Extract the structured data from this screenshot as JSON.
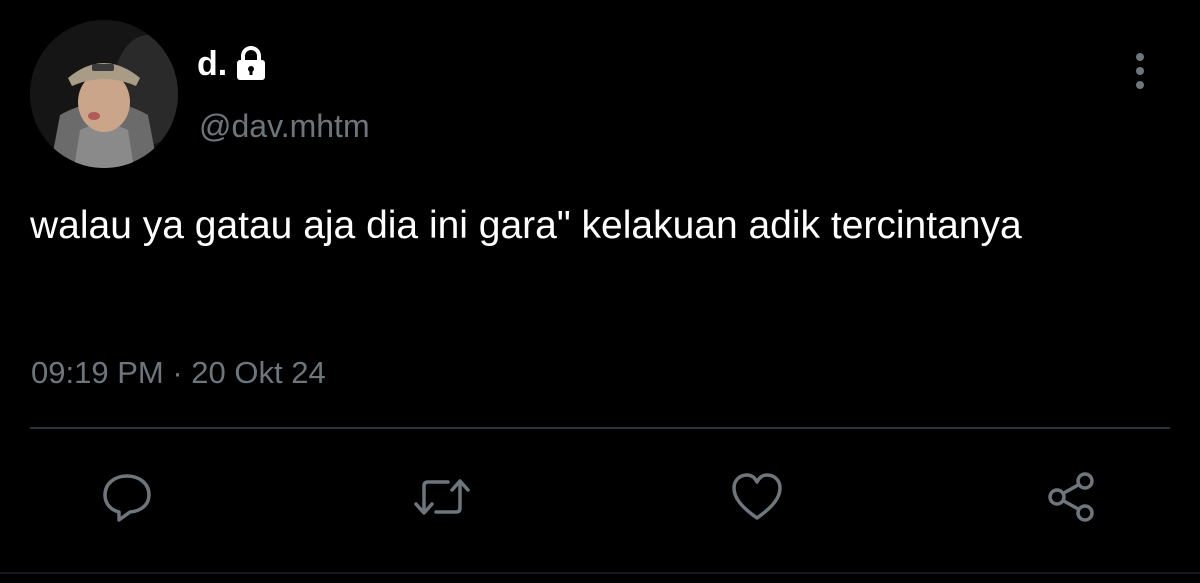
{
  "user": {
    "display_name": "d.",
    "handle": "@dav.mhtm",
    "protected": true,
    "avatar": "user-avatar-photo"
  },
  "tweet": {
    "text": "walau ya gatau aja dia ini gara\" kelakuan adik tercintanya",
    "time": "09:19 PM",
    "separator": " · ",
    "date": "20 Okt 24"
  },
  "actions": [
    {
      "name": "reply",
      "icon": "reply-icon"
    },
    {
      "name": "retweet",
      "icon": "retweet-icon"
    },
    {
      "name": "like",
      "icon": "heart-icon"
    },
    {
      "name": "share",
      "icon": "share-icon"
    }
  ],
  "colors": {
    "background": "#000000",
    "text_primary": "#ffffff",
    "text_secondary": "#6e767d",
    "divider": "#2f3336"
  }
}
